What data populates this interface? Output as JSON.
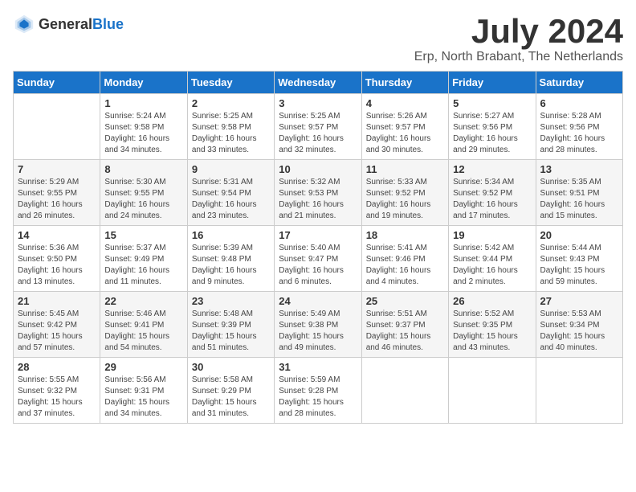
{
  "header": {
    "logo_general": "General",
    "logo_blue": "Blue",
    "month_title": "July 2024",
    "location": "Erp, North Brabant, The Netherlands"
  },
  "days_of_week": [
    "Sunday",
    "Monday",
    "Tuesday",
    "Wednesday",
    "Thursday",
    "Friday",
    "Saturday"
  ],
  "weeks": [
    [
      {
        "day": "",
        "info": ""
      },
      {
        "day": "1",
        "info": "Sunrise: 5:24 AM\nSunset: 9:58 PM\nDaylight: 16 hours\nand 34 minutes."
      },
      {
        "day": "2",
        "info": "Sunrise: 5:25 AM\nSunset: 9:58 PM\nDaylight: 16 hours\nand 33 minutes."
      },
      {
        "day": "3",
        "info": "Sunrise: 5:25 AM\nSunset: 9:57 PM\nDaylight: 16 hours\nand 32 minutes."
      },
      {
        "day": "4",
        "info": "Sunrise: 5:26 AM\nSunset: 9:57 PM\nDaylight: 16 hours\nand 30 minutes."
      },
      {
        "day": "5",
        "info": "Sunrise: 5:27 AM\nSunset: 9:56 PM\nDaylight: 16 hours\nand 29 minutes."
      },
      {
        "day": "6",
        "info": "Sunrise: 5:28 AM\nSunset: 9:56 PM\nDaylight: 16 hours\nand 28 minutes."
      }
    ],
    [
      {
        "day": "7",
        "info": "Sunrise: 5:29 AM\nSunset: 9:55 PM\nDaylight: 16 hours\nand 26 minutes."
      },
      {
        "day": "8",
        "info": "Sunrise: 5:30 AM\nSunset: 9:55 PM\nDaylight: 16 hours\nand 24 minutes."
      },
      {
        "day": "9",
        "info": "Sunrise: 5:31 AM\nSunset: 9:54 PM\nDaylight: 16 hours\nand 23 minutes."
      },
      {
        "day": "10",
        "info": "Sunrise: 5:32 AM\nSunset: 9:53 PM\nDaylight: 16 hours\nand 21 minutes."
      },
      {
        "day": "11",
        "info": "Sunrise: 5:33 AM\nSunset: 9:52 PM\nDaylight: 16 hours\nand 19 minutes."
      },
      {
        "day": "12",
        "info": "Sunrise: 5:34 AM\nSunset: 9:52 PM\nDaylight: 16 hours\nand 17 minutes."
      },
      {
        "day": "13",
        "info": "Sunrise: 5:35 AM\nSunset: 9:51 PM\nDaylight: 16 hours\nand 15 minutes."
      }
    ],
    [
      {
        "day": "14",
        "info": "Sunrise: 5:36 AM\nSunset: 9:50 PM\nDaylight: 16 hours\nand 13 minutes."
      },
      {
        "day": "15",
        "info": "Sunrise: 5:37 AM\nSunset: 9:49 PM\nDaylight: 16 hours\nand 11 minutes."
      },
      {
        "day": "16",
        "info": "Sunrise: 5:39 AM\nSunset: 9:48 PM\nDaylight: 16 hours\nand 9 minutes."
      },
      {
        "day": "17",
        "info": "Sunrise: 5:40 AM\nSunset: 9:47 PM\nDaylight: 16 hours\nand 6 minutes."
      },
      {
        "day": "18",
        "info": "Sunrise: 5:41 AM\nSunset: 9:46 PM\nDaylight: 16 hours\nand 4 minutes."
      },
      {
        "day": "19",
        "info": "Sunrise: 5:42 AM\nSunset: 9:44 PM\nDaylight: 16 hours\nand 2 minutes."
      },
      {
        "day": "20",
        "info": "Sunrise: 5:44 AM\nSunset: 9:43 PM\nDaylight: 15 hours\nand 59 minutes."
      }
    ],
    [
      {
        "day": "21",
        "info": "Sunrise: 5:45 AM\nSunset: 9:42 PM\nDaylight: 15 hours\nand 57 minutes."
      },
      {
        "day": "22",
        "info": "Sunrise: 5:46 AM\nSunset: 9:41 PM\nDaylight: 15 hours\nand 54 minutes."
      },
      {
        "day": "23",
        "info": "Sunrise: 5:48 AM\nSunset: 9:39 PM\nDaylight: 15 hours\nand 51 minutes."
      },
      {
        "day": "24",
        "info": "Sunrise: 5:49 AM\nSunset: 9:38 PM\nDaylight: 15 hours\nand 49 minutes."
      },
      {
        "day": "25",
        "info": "Sunrise: 5:51 AM\nSunset: 9:37 PM\nDaylight: 15 hours\nand 46 minutes."
      },
      {
        "day": "26",
        "info": "Sunrise: 5:52 AM\nSunset: 9:35 PM\nDaylight: 15 hours\nand 43 minutes."
      },
      {
        "day": "27",
        "info": "Sunrise: 5:53 AM\nSunset: 9:34 PM\nDaylight: 15 hours\nand 40 minutes."
      }
    ],
    [
      {
        "day": "28",
        "info": "Sunrise: 5:55 AM\nSunset: 9:32 PM\nDaylight: 15 hours\nand 37 minutes."
      },
      {
        "day": "29",
        "info": "Sunrise: 5:56 AM\nSunset: 9:31 PM\nDaylight: 15 hours\nand 34 minutes."
      },
      {
        "day": "30",
        "info": "Sunrise: 5:58 AM\nSunset: 9:29 PM\nDaylight: 15 hours\nand 31 minutes."
      },
      {
        "day": "31",
        "info": "Sunrise: 5:59 AM\nSunset: 9:28 PM\nDaylight: 15 hours\nand 28 minutes."
      },
      {
        "day": "",
        "info": ""
      },
      {
        "day": "",
        "info": ""
      },
      {
        "day": "",
        "info": ""
      }
    ]
  ]
}
